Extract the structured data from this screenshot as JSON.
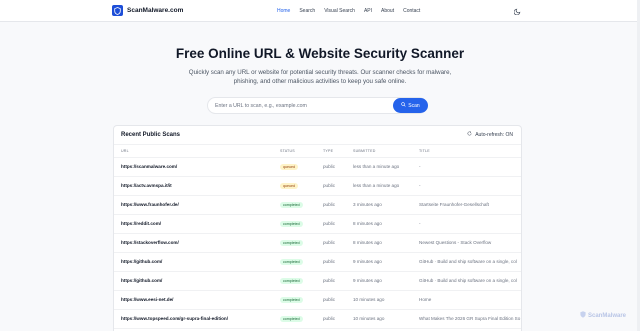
{
  "brand": {
    "name": "ScanMalware.com"
  },
  "nav": {
    "links": [
      {
        "label": "Home",
        "active": true
      },
      {
        "label": "Search",
        "active": false
      },
      {
        "label": "Visual Search",
        "active": false
      },
      {
        "label": "API",
        "active": false
      },
      {
        "label": "About",
        "active": false
      },
      {
        "label": "Contact",
        "active": false
      }
    ]
  },
  "hero": {
    "title": "Free Online URL & Website Security Scanner",
    "description": "Quickly scan any URL or website for potential security threats. Our scanner checks for malware, phishing, and other malicious activities to keep you safe online."
  },
  "search": {
    "placeholder": "Enter a URL to scan, e.g., example.com",
    "value": "",
    "button_label": "Scan"
  },
  "recent": {
    "title": "Recent Public Scans",
    "autorefresh_label": "Auto-refresh: ON",
    "columns": [
      "URL",
      "STATUS",
      "TYPE",
      "SUBMITTED",
      "TITLE"
    ],
    "rows": [
      {
        "url": "https://scanmalware.com/",
        "status": "queued",
        "type": "public",
        "submitted": "less than a minute ago",
        "title": "-"
      },
      {
        "url": "https://actv.avmspa.it/it",
        "status": "queued",
        "type": "public",
        "submitted": "less than a minute ago",
        "title": "-"
      },
      {
        "url": "https://www.fraunhofer.de/",
        "status": "completed",
        "type": "public",
        "submitted": "3 minutes ago",
        "title": "Startseite Fraunhofer-Gesellschaft"
      },
      {
        "url": "https://reddit.com/",
        "status": "completed",
        "type": "public",
        "submitted": "8 minutes ago",
        "title": "-"
      },
      {
        "url": "https://stackoverflow.com/",
        "status": "completed",
        "type": "public",
        "submitted": "8 minutes ago",
        "title": "Newest Questions - Stack Overflow"
      },
      {
        "url": "https://github.com/",
        "status": "completed",
        "type": "public",
        "submitted": "9 minutes ago",
        "title": "GitHub · Build and ship software on a single, col"
      },
      {
        "url": "https://github.com/",
        "status": "completed",
        "type": "public",
        "submitted": "9 minutes ago",
        "title": "GitHub · Build and ship software on a single, col"
      },
      {
        "url": "https://www.eesi-net.de/",
        "status": "completed",
        "type": "public",
        "submitted": "10 minutes ago",
        "title": "Home"
      },
      {
        "url": "https://www.topspeed.com/gr-supra-final-edition/",
        "status": "completed",
        "type": "public",
        "submitted": "10 minutes ago",
        "title": "What Makes The 2026 GR Supra Final Edition So"
      }
    ]
  },
  "watermark": {
    "text": "ScanMalware"
  },
  "colors": {
    "accent": "#2563eb",
    "brand_dark": "#1d4ed8",
    "queued_bg": "#fef3c7",
    "completed_bg": "#dcfce7"
  },
  "icons": {
    "logo": "shield-icon",
    "theme": "moon-icon",
    "scan": "search-icon",
    "refresh": "refresh-icon"
  }
}
